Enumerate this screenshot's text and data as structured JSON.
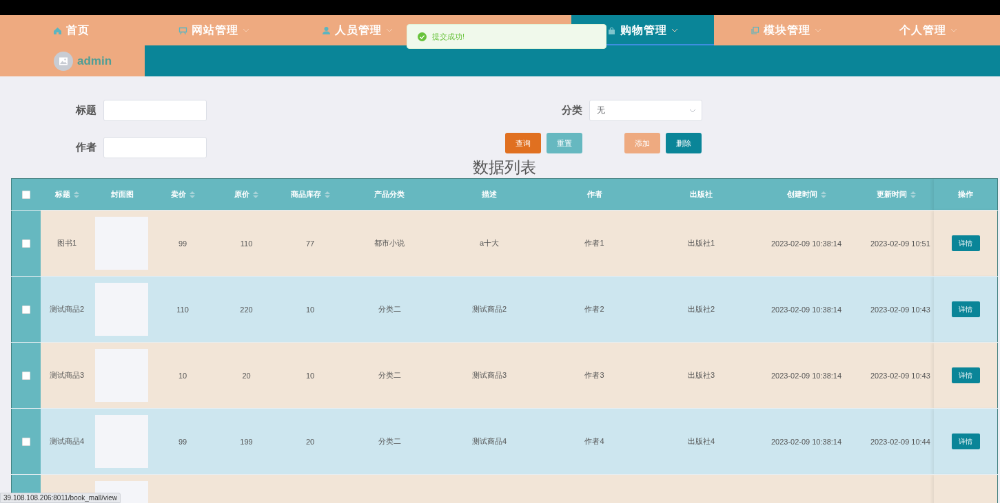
{
  "nav": {
    "items": [
      {
        "label": "首页",
        "kind": "home",
        "dropdown": false,
        "selected": false
      },
      {
        "label": "网站管理",
        "kind": "board",
        "dropdown": true,
        "selected": false
      },
      {
        "label": "人员管理",
        "kind": "person",
        "dropdown": true,
        "selected": false
      },
      {
        "label": "购物管理",
        "kind": "bag",
        "dropdown": true,
        "selected": true
      },
      {
        "label": "模块管理",
        "kind": "copy",
        "dropdown": true,
        "selected": false
      },
      {
        "label": "个人管理",
        "kind": "plain",
        "dropdown": true,
        "selected": false
      }
    ],
    "user": "admin"
  },
  "toast": {
    "kind": "success",
    "message": "提交成功!"
  },
  "search": {
    "fields": [
      {
        "label": "标题",
        "kind": "input"
      },
      {
        "label": "作者",
        "kind": "input"
      }
    ],
    "category": {
      "label": "分类",
      "value": "无"
    },
    "buttons": [
      {
        "label": "查询",
        "kind": "query"
      },
      {
        "label": "重置",
        "kind": "reset"
      },
      {
        "label": "添加",
        "kind": "add"
      },
      {
        "label": "删除",
        "kind": "delete"
      }
    ]
  },
  "table": {
    "title": "数据列表",
    "all_checked": false,
    "columns": [
      {
        "label": "标题",
        "sortable": true,
        "kind": "text"
      },
      {
        "label": "封面图",
        "sortable": false,
        "kind": "image"
      },
      {
        "label": "卖价",
        "sortable": true,
        "kind": "text"
      },
      {
        "label": "原价",
        "sortable": true,
        "kind": "text"
      },
      {
        "label": "商品库存",
        "sortable": true,
        "kind": "text"
      },
      {
        "label": "产品分类",
        "sortable": false,
        "kind": "text"
      },
      {
        "label": "描述",
        "sortable": false,
        "kind": "text"
      },
      {
        "label": "作者",
        "sortable": false,
        "kind": "text"
      },
      {
        "label": "出版社",
        "sortable": false,
        "kind": "text"
      },
      {
        "label": "创建时间",
        "sortable": true,
        "kind": "text"
      },
      {
        "label": "更新时间",
        "sortable": true,
        "kind": "text"
      },
      {
        "label": "操作",
        "sortable": false,
        "kind": "action"
      }
    ],
    "rows": [
      {
        "checked": false,
        "cells": [
          "图书1",
          "",
          "99",
          "110",
          "77",
          "都市小说",
          "a十大",
          "作者1",
          "出版社1",
          "2023-02-09 10:38:14",
          "2023-02-09 10:51",
          "详情"
        ]
      },
      {
        "checked": false,
        "cells": [
          "测试商品2",
          "",
          "110",
          "220",
          "10",
          "分类二",
          "测试商品2",
          "作者2",
          "出版社2",
          "2023-02-09 10:38:14",
          "2023-02-09 10:43",
          "详情"
        ]
      },
      {
        "checked": false,
        "cells": [
          "测试商品3",
          "",
          "10",
          "20",
          "10",
          "分类二",
          "测试商品3",
          "作者3",
          "出版社3",
          "2023-02-09 10:38:14",
          "2023-02-09 10:43",
          "详情"
        ]
      },
      {
        "checked": false,
        "cells": [
          "测试商品4",
          "",
          "99",
          "199",
          "20",
          "分类二",
          "测试商品4",
          "作者4",
          "出版社4",
          "2023-02-09 10:38:14",
          "2023-02-09 10:44",
          "详情"
        ]
      }
    ],
    "more_rows_below": true
  },
  "status_url": "39.108.108.206:8011/book_mall/view"
}
